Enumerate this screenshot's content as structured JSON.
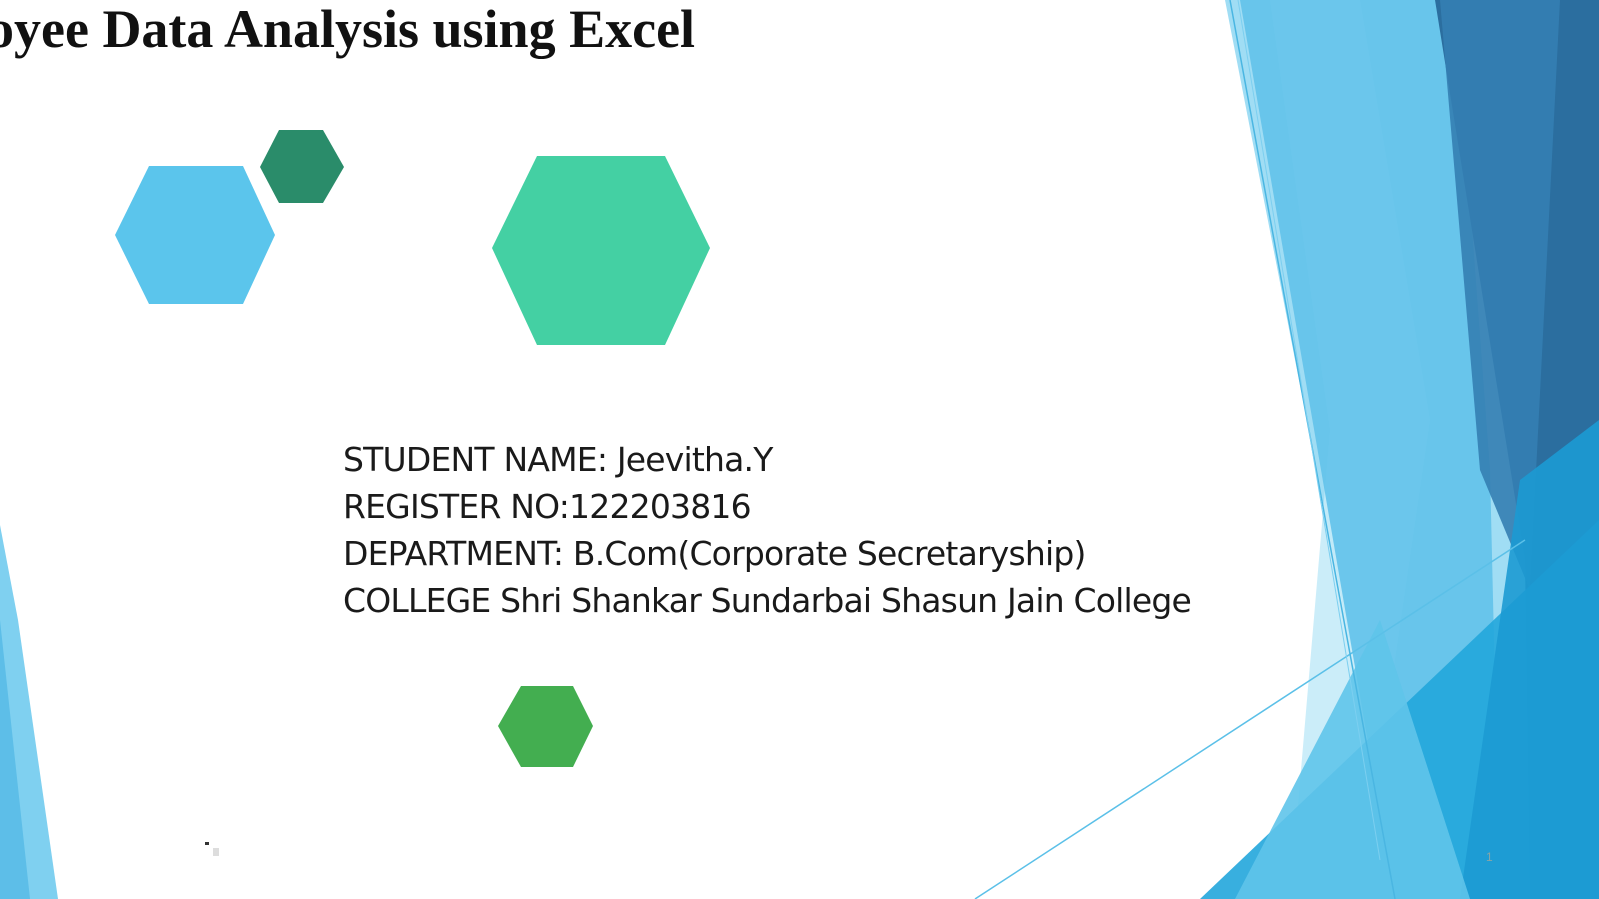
{
  "slide": {
    "title": "loyee Data Analysis using Excel",
    "info_lines": [
      "STUDENT NAME: Jeevitha.Y",
      "REGISTER NO:122203816",
      "DEPARTMENT: B.Com(Corporate Secretaryship)",
      "COLLEGE Shri Shankar Sundarbai Shasun Jain College"
    ],
    "slide_number": "1"
  },
  "theme": {
    "hex_light_blue": "#5bc5ec",
    "hex_dark_green": "#2a8c6a",
    "hex_teal": "#44d0a3",
    "hex_green": "#43ae50",
    "facet_light": "#80d1ef",
    "facet_mid": "#4fb6e4",
    "facet_dark": "#2c6f9e",
    "facet_bright": "#23a5dd"
  },
  "decorations": {
    "shape": "hexagon-icon"
  }
}
